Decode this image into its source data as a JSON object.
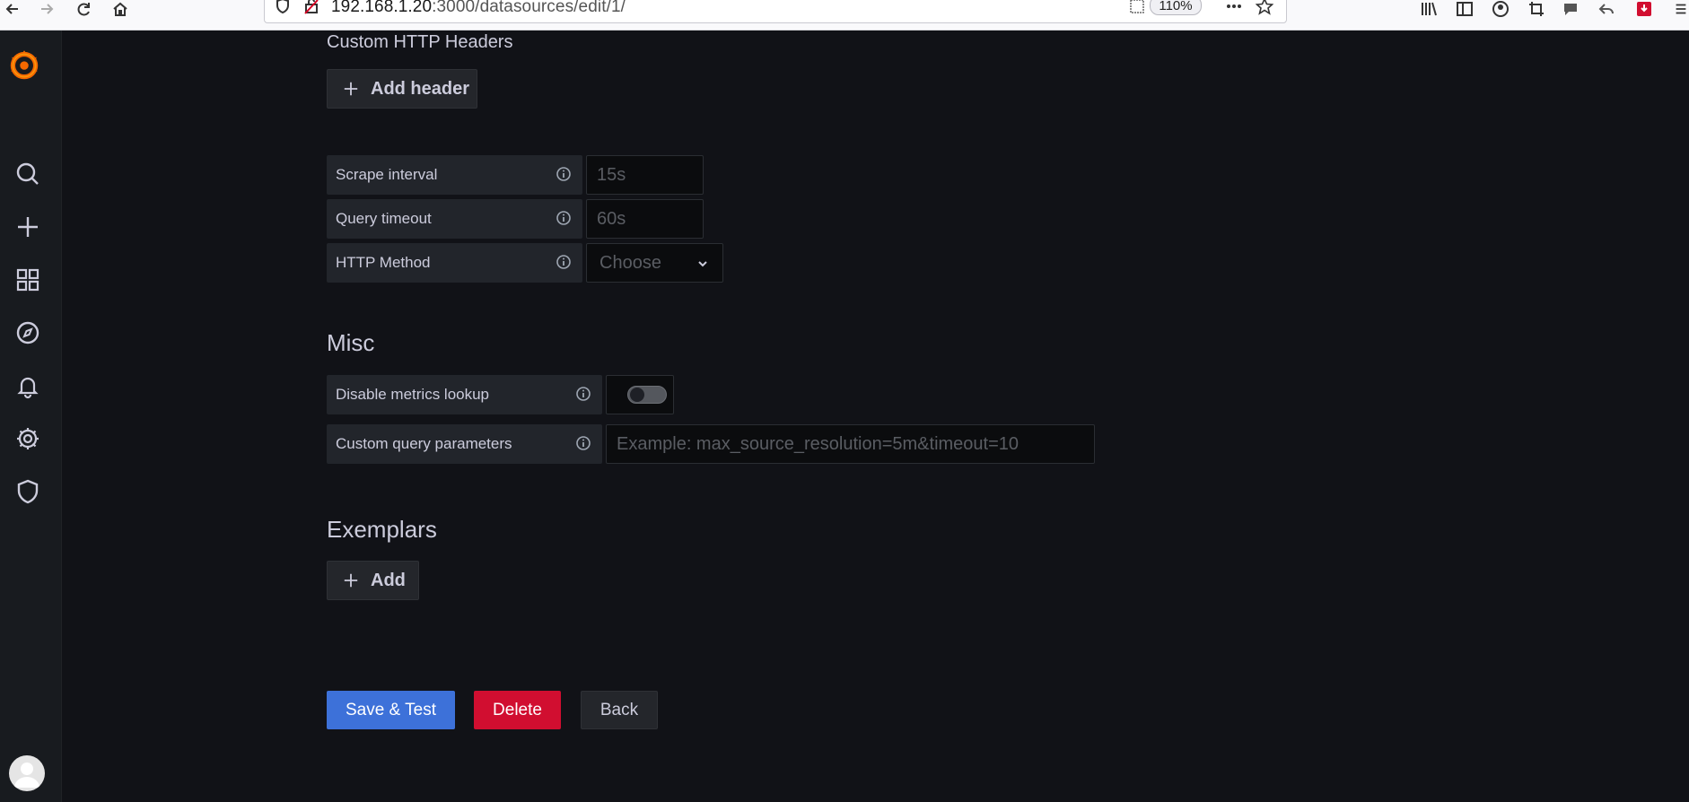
{
  "browser": {
    "url_host": "192.168.1.20",
    "url_rest": ":3000/datasources/edit/1/",
    "zoom": "110%"
  },
  "sidebar": {
    "items": [
      "search",
      "create",
      "dashboards",
      "explore",
      "alerting",
      "configuration",
      "server-admin"
    ]
  },
  "http": {
    "custom_headers_label": "Custom HTTP Headers",
    "add_header_label": "Add header",
    "scrape_interval_label": "Scrape interval",
    "scrape_interval_placeholder": "15s",
    "query_timeout_label": "Query timeout",
    "query_timeout_placeholder": "60s",
    "http_method_label": "HTTP Method",
    "http_method_placeholder": "Choose"
  },
  "misc": {
    "title": "Misc",
    "disable_metrics_lookup_label": "Disable metrics lookup",
    "disable_metrics_lookup_value": false,
    "custom_query_params_label": "Custom query parameters",
    "custom_query_params_placeholder": "Example: max_source_resolution=5m&timeout=10"
  },
  "exemplars": {
    "title": "Exemplars",
    "add_label": "Add"
  },
  "actions": {
    "save_test": "Save & Test",
    "delete": "Delete",
    "back": "Back"
  },
  "colors": {
    "primary": "#3d71d9",
    "danger": "#d10e30",
    "background": "#111217",
    "logo": "#f46800"
  }
}
